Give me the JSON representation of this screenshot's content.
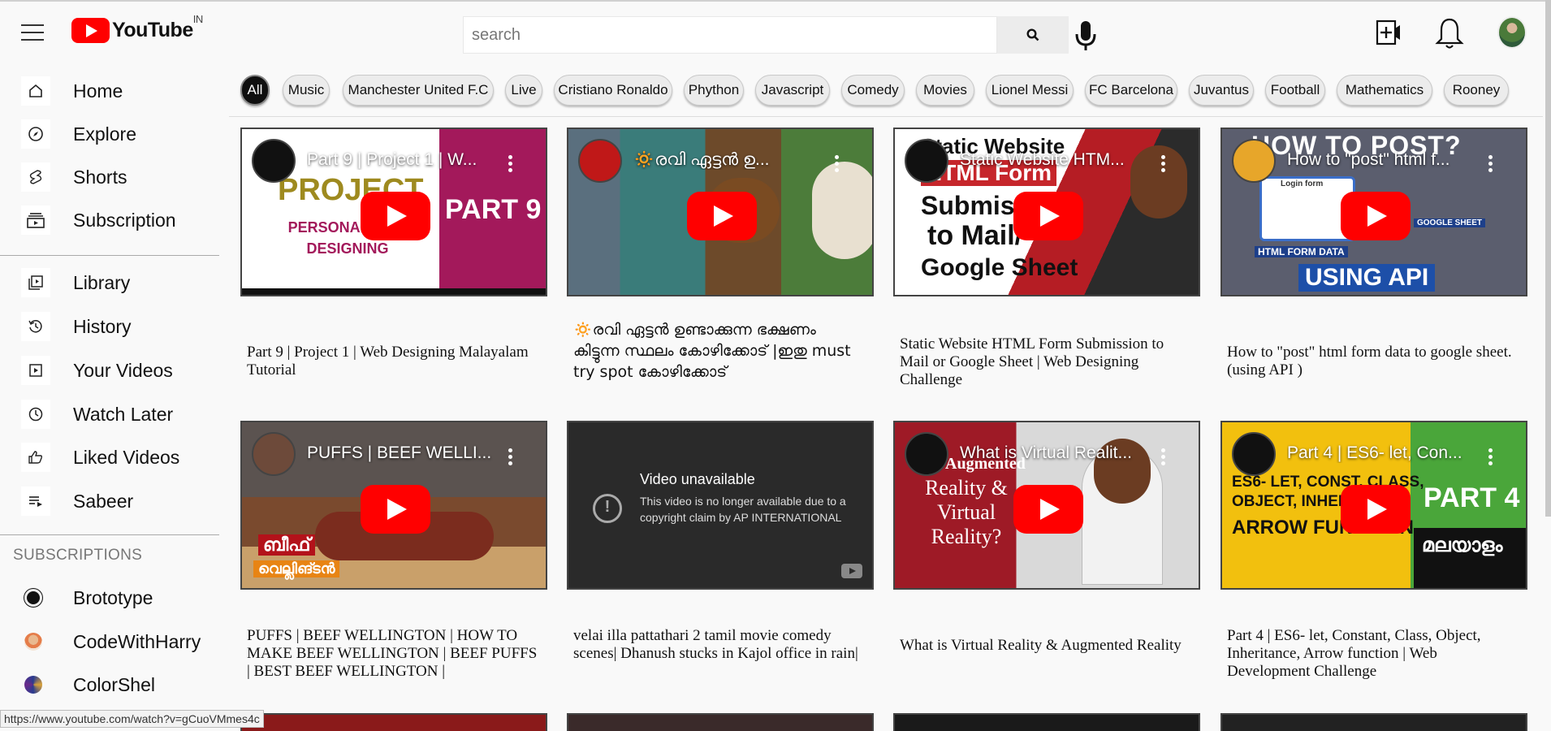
{
  "header": {
    "logo_text": "YouTube",
    "logo_region": "IN",
    "search_placeholder": "search"
  },
  "sidebar": {
    "items": [
      {
        "label": "Home",
        "icon": "home-icon"
      },
      {
        "label": "Explore",
        "icon": "compass-icon"
      },
      {
        "label": "Shorts",
        "icon": "shorts-icon"
      },
      {
        "label": "Subscription",
        "icon": "subscriptions-icon"
      },
      {
        "label": "Library",
        "icon": "library-icon"
      },
      {
        "label": "History",
        "icon": "history-icon"
      },
      {
        "label": "Your Videos",
        "icon": "your-videos-icon"
      },
      {
        "label": "Watch Later",
        "icon": "clock-icon"
      },
      {
        "label": "Liked Videos",
        "icon": "thumbs-up-icon"
      },
      {
        "label": "Sabeer",
        "icon": "playlist-icon"
      }
    ],
    "subscriptions_heading": "SUBSCRIPTIONS",
    "subscriptions": [
      {
        "label": "Brototype"
      },
      {
        "label": "CodeWithHarry"
      },
      {
        "label": "ColorShel"
      }
    ]
  },
  "chips": [
    "All",
    "Music",
    "Manchester United F.C",
    "Live",
    "Cristiano Ronaldo",
    "Phython",
    "Javascript",
    "Comedy",
    "Movies",
    "Lionel Messi",
    "FC Barcelona",
    "Juvantus",
    "Football",
    "Mathematics",
    "Rooney"
  ],
  "videos": [
    {
      "thumb_title": "Part 9 | Project 1 | W...",
      "title": "Part 9 | Project 1 | Web Designing Malayalam Tutorial",
      "art1": "PROJECT",
      "art2": "PERSONAL WEB DESIGNING",
      "art3": "PART 9"
    },
    {
      "thumb_title": "🔅രവി ഏട്ടൻ ഉ...",
      "title": "🔅രവി ഏട്ടൻ ഉണ്ടാക്കുന്ന ഭക്ഷണം കിട്ടുന്ന സ്ഥലം കോഴിക്കോട് |ഇതു must try spot കോഴിക്കോട്"
    },
    {
      "thumb_title": "Static Website HTM...",
      "title": "Static Website HTML Form Submission to Mail or Google Sheet | Web Designing Challenge",
      "art1": "Static Website",
      "art2": "HTML Form",
      "art3": "Submis",
      "art4": "to Mail/",
      "art5": "Google Sheet"
    },
    {
      "thumb_title": "How to \"post\" html f...",
      "title": "How to \"post\" html form data to google sheet. (using API )",
      "art1": "HOW TO POST?",
      "art2": "Login form",
      "art3": "HTML FORM DATA",
      "art4": "GOOGLE SHEET",
      "art5": "USING API"
    },
    {
      "thumb_title": "PUFFS | BEEF WELLI...",
      "title": "PUFFS | BEEF WELLINGTON | HOW TO MAKE BEEF WELLINGTON | BEEF PUFFS | BEST BEEF WELLINGTON |",
      "art1": "ബീഫ്",
      "art2": "വെല്ലിങ്ടൻ"
    },
    {
      "thumb_title": "",
      "title": "velai illa pattathari 2 tamil movie comedy scenes| Dhanush stucks in Kajol office in rain|",
      "unavailable_title": "Video unavailable",
      "unavailable_msg": "This video is no longer available due to a copyright claim by AP INTERNATIONAL"
    },
    {
      "thumb_title": "What is Virtual Realit...",
      "title": "What is Virtual Reality & Augmented Reality",
      "art1": "Augmented",
      "art2": "Reality & Virtual Reality?"
    },
    {
      "thumb_title": "Part 4 | ES6- let, Con...",
      "title": "Part 4 | ES6- let, Constant, Class, Object, Inheritance, Arrow function | Web Development Challenge",
      "art1": "ES6- LET, CONST, CLASS, OBJECT, INHER",
      "art2": "ARROW FUNCTION",
      "art3": "PART 4",
      "art4": "മലയാളം"
    }
  ],
  "status_url": "https://www.youtube.com/watch?v=gCuoVMmes4c",
  "colors": {
    "brand": "#ff0000",
    "chip_active": "#0f0f0f",
    "chip_bg": "#ececec"
  }
}
